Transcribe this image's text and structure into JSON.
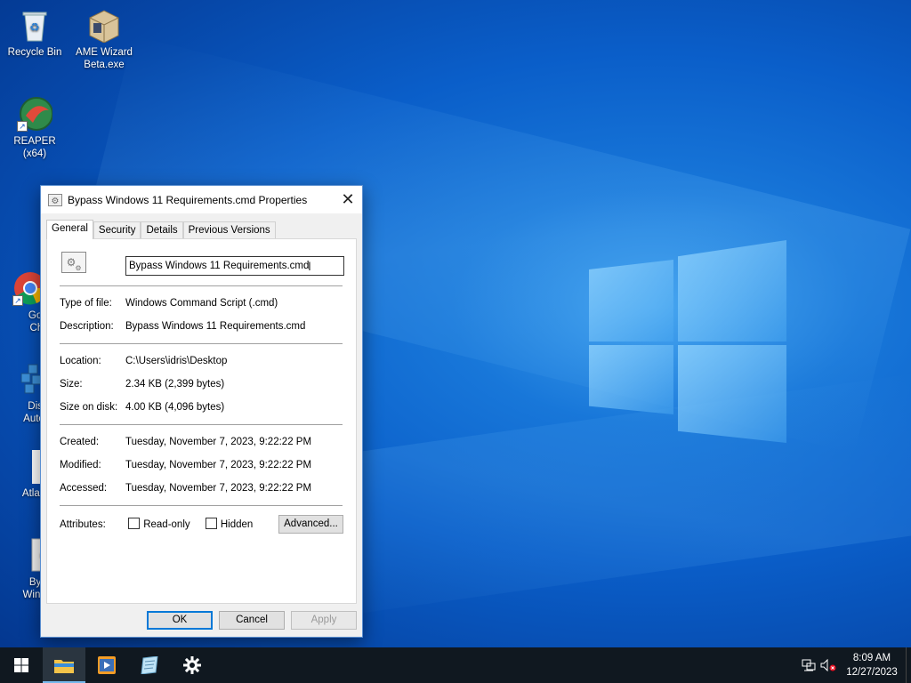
{
  "desktop": {
    "icons": [
      {
        "label": "Recycle Bin"
      },
      {
        "label": "AME Wizard Beta.exe"
      },
      {
        "label": "REAPER (x64)"
      },
      {
        "label": "Goog Chro"
      },
      {
        "label": "Disab Automa"
      },
      {
        "label": "AtlasPla"
      },
      {
        "label": "Bypa Window"
      }
    ]
  },
  "dialog": {
    "title": "Bypass Windows 11 Requirements.cmd Properties",
    "close_symbol": "✕",
    "tabs": [
      "General",
      "Security",
      "Details",
      "Previous Versions"
    ],
    "active_tab": "General",
    "file_name": "Bypass Windows 11 Requirements.cmd",
    "fields": {
      "type_label": "Type of file:",
      "type_value": "Windows Command Script (.cmd)",
      "description_label": "Description:",
      "description_value": "Bypass Windows 11 Requirements.cmd",
      "location_label": "Location:",
      "location_value": "C:\\Users\\idris\\Desktop",
      "size_label": "Size:",
      "size_value": "2.34 KB (2,399 bytes)",
      "size_on_disk_label": "Size on disk:",
      "size_on_disk_value": "4.00 KB (4,096 bytes)",
      "created_label": "Created:",
      "created_value": "Tuesday, November 7, 2023, 9:22:22 PM",
      "modified_label": "Modified:",
      "modified_value": "Tuesday, November 7, 2023, 9:22:22 PM",
      "accessed_label": "Accessed:",
      "accessed_value": "Tuesday, November 7, 2023, 9:22:22 PM",
      "attributes_label": "Attributes:",
      "readonly_label": "Read-only",
      "hidden_label": "Hidden",
      "advanced_label": "Advanced..."
    },
    "buttons": {
      "ok": "OK",
      "cancel": "Cancel",
      "apply": "Apply"
    }
  },
  "taskbar": {
    "items": [
      "start-icon",
      "file-explorer-icon",
      "media-player-icon",
      "notepad-icon",
      "settings-icon"
    ],
    "clock_time": "8:09 AM",
    "clock_date": "12/27/2023"
  }
}
